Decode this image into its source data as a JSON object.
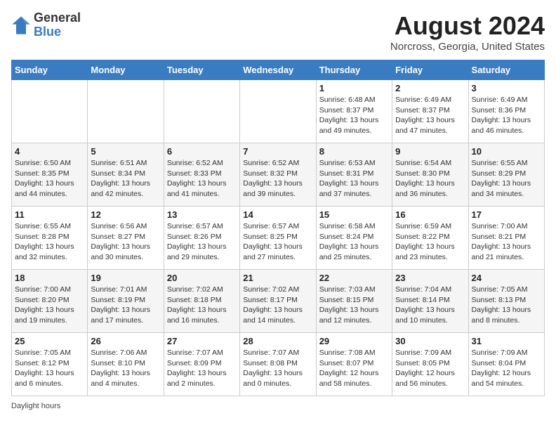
{
  "logo": {
    "general": "General",
    "blue": "Blue"
  },
  "title": {
    "month_year": "August 2024",
    "location": "Norcross, Georgia, United States"
  },
  "weekdays": [
    "Sunday",
    "Monday",
    "Tuesday",
    "Wednesday",
    "Thursday",
    "Friday",
    "Saturday"
  ],
  "weeks": [
    [
      {
        "day": "",
        "info": ""
      },
      {
        "day": "",
        "info": ""
      },
      {
        "day": "",
        "info": ""
      },
      {
        "day": "",
        "info": ""
      },
      {
        "day": "1",
        "info": "Sunrise: 6:48 AM\nSunset: 8:37 PM\nDaylight: 13 hours\nand 49 minutes."
      },
      {
        "day": "2",
        "info": "Sunrise: 6:49 AM\nSunset: 8:37 PM\nDaylight: 13 hours\nand 47 minutes."
      },
      {
        "day": "3",
        "info": "Sunrise: 6:49 AM\nSunset: 8:36 PM\nDaylight: 13 hours\nand 46 minutes."
      }
    ],
    [
      {
        "day": "4",
        "info": "Sunrise: 6:50 AM\nSunset: 8:35 PM\nDaylight: 13 hours\nand 44 minutes."
      },
      {
        "day": "5",
        "info": "Sunrise: 6:51 AM\nSunset: 8:34 PM\nDaylight: 13 hours\nand 42 minutes."
      },
      {
        "day": "6",
        "info": "Sunrise: 6:52 AM\nSunset: 8:33 PM\nDaylight: 13 hours\nand 41 minutes."
      },
      {
        "day": "7",
        "info": "Sunrise: 6:52 AM\nSunset: 8:32 PM\nDaylight: 13 hours\nand 39 minutes."
      },
      {
        "day": "8",
        "info": "Sunrise: 6:53 AM\nSunset: 8:31 PM\nDaylight: 13 hours\nand 37 minutes."
      },
      {
        "day": "9",
        "info": "Sunrise: 6:54 AM\nSunset: 8:30 PM\nDaylight: 13 hours\nand 36 minutes."
      },
      {
        "day": "10",
        "info": "Sunrise: 6:55 AM\nSunset: 8:29 PM\nDaylight: 13 hours\nand 34 minutes."
      }
    ],
    [
      {
        "day": "11",
        "info": "Sunrise: 6:55 AM\nSunset: 8:28 PM\nDaylight: 13 hours\nand 32 minutes."
      },
      {
        "day": "12",
        "info": "Sunrise: 6:56 AM\nSunset: 8:27 PM\nDaylight: 13 hours\nand 30 minutes."
      },
      {
        "day": "13",
        "info": "Sunrise: 6:57 AM\nSunset: 8:26 PM\nDaylight: 13 hours\nand 29 minutes."
      },
      {
        "day": "14",
        "info": "Sunrise: 6:57 AM\nSunset: 8:25 PM\nDaylight: 13 hours\nand 27 minutes."
      },
      {
        "day": "15",
        "info": "Sunrise: 6:58 AM\nSunset: 8:24 PM\nDaylight: 13 hours\nand 25 minutes."
      },
      {
        "day": "16",
        "info": "Sunrise: 6:59 AM\nSunset: 8:22 PM\nDaylight: 13 hours\nand 23 minutes."
      },
      {
        "day": "17",
        "info": "Sunrise: 7:00 AM\nSunset: 8:21 PM\nDaylight: 13 hours\nand 21 minutes."
      }
    ],
    [
      {
        "day": "18",
        "info": "Sunrise: 7:00 AM\nSunset: 8:20 PM\nDaylight: 13 hours\nand 19 minutes."
      },
      {
        "day": "19",
        "info": "Sunrise: 7:01 AM\nSunset: 8:19 PM\nDaylight: 13 hours\nand 17 minutes."
      },
      {
        "day": "20",
        "info": "Sunrise: 7:02 AM\nSunset: 8:18 PM\nDaylight: 13 hours\nand 16 minutes."
      },
      {
        "day": "21",
        "info": "Sunrise: 7:02 AM\nSunset: 8:17 PM\nDaylight: 13 hours\nand 14 minutes."
      },
      {
        "day": "22",
        "info": "Sunrise: 7:03 AM\nSunset: 8:15 PM\nDaylight: 13 hours\nand 12 minutes."
      },
      {
        "day": "23",
        "info": "Sunrise: 7:04 AM\nSunset: 8:14 PM\nDaylight: 13 hours\nand 10 minutes."
      },
      {
        "day": "24",
        "info": "Sunrise: 7:05 AM\nSunset: 8:13 PM\nDaylight: 13 hours\nand 8 minutes."
      }
    ],
    [
      {
        "day": "25",
        "info": "Sunrise: 7:05 AM\nSunset: 8:12 PM\nDaylight: 13 hours\nand 6 minutes."
      },
      {
        "day": "26",
        "info": "Sunrise: 7:06 AM\nSunset: 8:10 PM\nDaylight: 13 hours\nand 4 minutes."
      },
      {
        "day": "27",
        "info": "Sunrise: 7:07 AM\nSunset: 8:09 PM\nDaylight: 13 hours\nand 2 minutes."
      },
      {
        "day": "28",
        "info": "Sunrise: 7:07 AM\nSunset: 8:08 PM\nDaylight: 13 hours\nand 0 minutes."
      },
      {
        "day": "29",
        "info": "Sunrise: 7:08 AM\nSunset: 8:07 PM\nDaylight: 12 hours\nand 58 minutes."
      },
      {
        "day": "30",
        "info": "Sunrise: 7:09 AM\nSunset: 8:05 PM\nDaylight: 12 hours\nand 56 minutes."
      },
      {
        "day": "31",
        "info": "Sunrise: 7:09 AM\nSunset: 8:04 PM\nDaylight: 12 hours\nand 54 minutes."
      }
    ]
  ],
  "legend": "Daylight hours"
}
